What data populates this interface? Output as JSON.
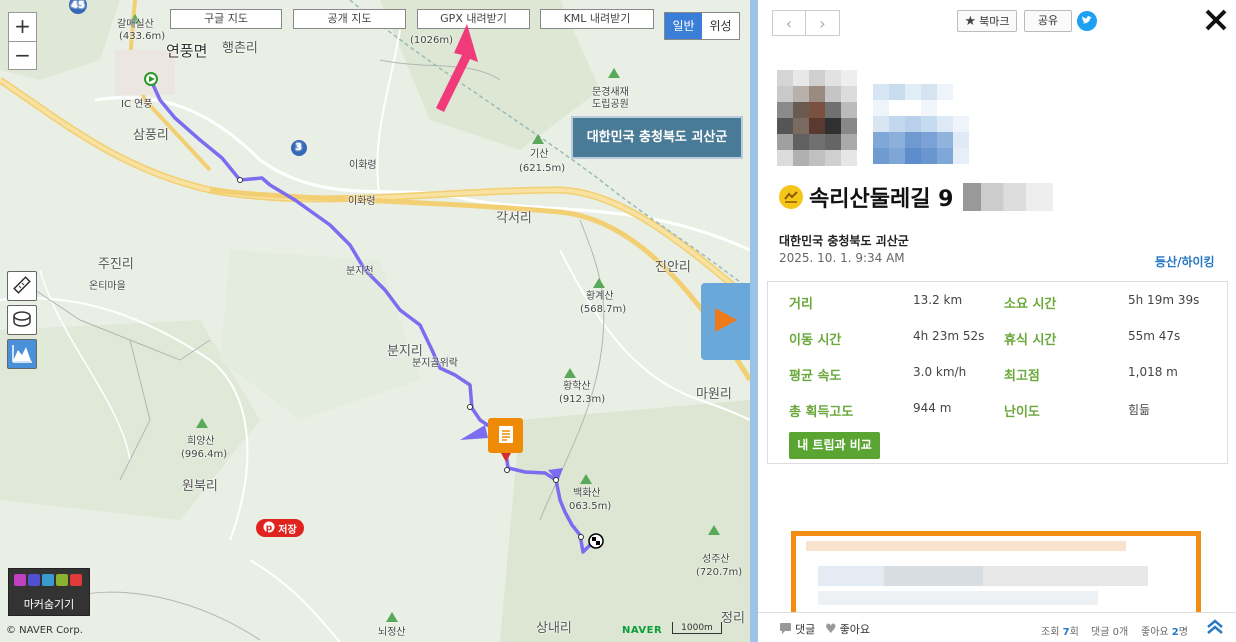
{
  "map": {
    "zoom_in": "+",
    "zoom_out": "−",
    "buttons": {
      "google": "구글 지도",
      "public": "공개 지도",
      "gpx": "GPX 내려받기",
      "kml": "KML 내려받기"
    },
    "map_types": {
      "normal": "일반",
      "satellite": "위성"
    },
    "region_box": "대한민국 충청북도 괴산군",
    "labels": {
      "road_45": "45",
      "road_3": "3",
      "galmae": "갈매실산",
      "galmae_h": "(433.6m)",
      "yeonpung": "연풍면",
      "haengchon": "행촌리",
      "ic": "IC 연풍",
      "sampung": "삼풍리",
      "ihwa1": "이화령",
      "ihwa2": "이화령",
      "mt1026": "(1026m)",
      "mungyeong": "문경새재\n도립공원",
      "gisan": "기산",
      "gisan_h": "(621.5m)",
      "gakseo": "각서리",
      "jujin": "주진리",
      "onti": "온티마을",
      "bunji_stream": "분지천",
      "jinan": "진안리",
      "hwanggye": "황계산",
      "hwanggye_h": "(568.7m)",
      "bunji": "분지리",
      "bunjigol": "분지골위락",
      "mawon": "마원리",
      "hwanghak": "황학산",
      "hwanghak_h": "(912.3m)",
      "huiyang": "희양산",
      "huiyang_h": "(996.4m)",
      "baekhwa": "백화산",
      "baekhwa_h": "063.5m)",
      "wonbuk": "원북리",
      "seongju": "성주산",
      "seongju_h": "(720.7m)",
      "sangnae": "상내리",
      "jeong": "정리",
      "noejeong": "뇌정산"
    },
    "save_pin": "저장",
    "marker_toggle": "마커숨기기",
    "copyright": "© NAVER Corp.",
    "naver": "NAVER",
    "scale": "1000m"
  },
  "panel": {
    "bookmark": "북마크",
    "share": "공유",
    "title": "속리산둘레길 9",
    "region": "대한민국 충청북도 괴산군",
    "date": "2025. 10. 1. 9:34 AM",
    "category": "등산/하이킹",
    "stats": [
      {
        "label": "거리",
        "value": "13.2 km",
        "label2": "소요 시간",
        "value2": "5h 19m 39s"
      },
      {
        "label": "이동 시간",
        "value": "4h 23m 52s",
        "label2": "휴식 시간",
        "value2": "55m 47s"
      },
      {
        "label": "평균 속도",
        "value": "3.0 km/h",
        "label2": "최고점",
        "value2": "1,018 m"
      },
      {
        "label": "총 획득고도",
        "value": "944 m",
        "label2": "난이도",
        "value2": "힘듦"
      }
    ],
    "compare_button": "내 트립과 비교",
    "footer": {
      "comment": "댓글",
      "like": "좋아요",
      "views_label": "조회",
      "views": "7",
      "views_unit": "회",
      "comments_text": "댓글 0개",
      "likes_label": "좋아요",
      "likes": "2",
      "likes_unit": "명"
    }
  },
  "colors": {
    "route": "#7b6cf0",
    "accent_blue": "#3b7ed8",
    "stat_green": "#6aa83a",
    "compare_green": "#5aa532",
    "orange": "#f38c12"
  }
}
